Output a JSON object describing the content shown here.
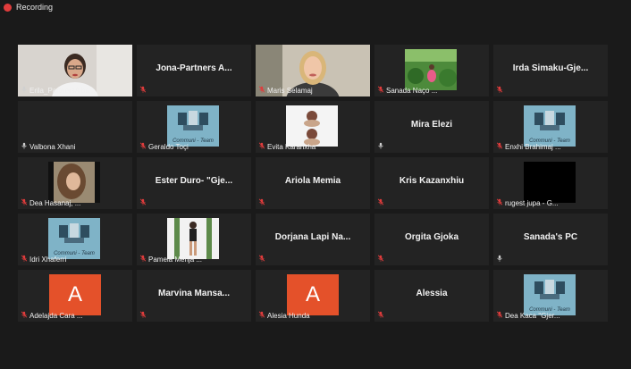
{
  "recording": {
    "label": "Recording"
  },
  "tiles": [
    {
      "name": "Erila_PartnersAlba...",
      "center": "",
      "type": "video-woman-glasses",
      "muted": false
    },
    {
      "name": "",
      "center": "Jona-Partners A...",
      "type": "text",
      "muted": true
    },
    {
      "name": "Maris Selamaj",
      "center": "",
      "type": "video-woman-blonde",
      "muted": true,
      "active": true
    },
    {
      "name": "Sanada Naço ...",
      "center": "",
      "type": "photo-garden",
      "muted": true
    },
    {
      "name": "",
      "center": "Irda Simaku-Gje...",
      "type": "text",
      "muted": true
    },
    {
      "name": "Valbona Xhani",
      "center": "",
      "type": "blank",
      "muted": false
    },
    {
      "name": "Geraldo Toçi",
      "center": "",
      "type": "logo",
      "muted": true
    },
    {
      "name": "Evita Karanxha",
      "center": "",
      "type": "photo-portrait2",
      "muted": true
    },
    {
      "name": "",
      "center": "Mira Elezi",
      "type": "text",
      "muted": false
    },
    {
      "name": "Enxhi Brahimaj ...",
      "center": "",
      "type": "logo",
      "muted": true
    },
    {
      "name": "Dea Hasanaj, ...",
      "center": "",
      "type": "photo-hair",
      "muted": true
    },
    {
      "name": "",
      "center": "Ester Duro- \"Gje...",
      "type": "text",
      "muted": true
    },
    {
      "name": "",
      "center": "Ariola Memia",
      "type": "text",
      "muted": true
    },
    {
      "name": "",
      "center": "Kris Kazanxhiu",
      "type": "text",
      "muted": true
    },
    {
      "name": "rugest jupa - G...",
      "center": "",
      "type": "black",
      "muted": true
    },
    {
      "name": "Idri Xhaferri",
      "center": "",
      "type": "logo",
      "muted": true
    },
    {
      "name": "Pamela Mehja ...",
      "center": "",
      "type": "photo-standing",
      "muted": true
    },
    {
      "name": "",
      "center": "Dorjana Lapi Na...",
      "type": "text",
      "muted": true
    },
    {
      "name": "",
      "center": "Orgita Gjoka",
      "type": "text",
      "muted": true
    },
    {
      "name": "",
      "center": "Sanada's PC",
      "type": "text",
      "muted": false
    },
    {
      "name": "Adelajda Cara ...",
      "center": "",
      "type": "avatar",
      "letter": "A",
      "muted": true
    },
    {
      "name": "",
      "center": "Marvina Mansa...",
      "type": "text",
      "muted": true
    },
    {
      "name": "Alesia Hunda",
      "center": "",
      "type": "avatar",
      "letter": "A",
      "muted": true
    },
    {
      "name": "",
      "center": "Alessia",
      "type": "text",
      "muted": true
    },
    {
      "name": "Dea Kaca \"Gjer...",
      "center": "",
      "type": "logo",
      "muted": true
    }
  ],
  "logo": {
    "line1": "Communi - Team"
  },
  "colors": {
    "active_border": "#d8d84a",
    "avatar": "#e4512a",
    "mic_muted": "#e03c3c",
    "tile": "#232323",
    "logo_bg": "#7fb3c7"
  }
}
